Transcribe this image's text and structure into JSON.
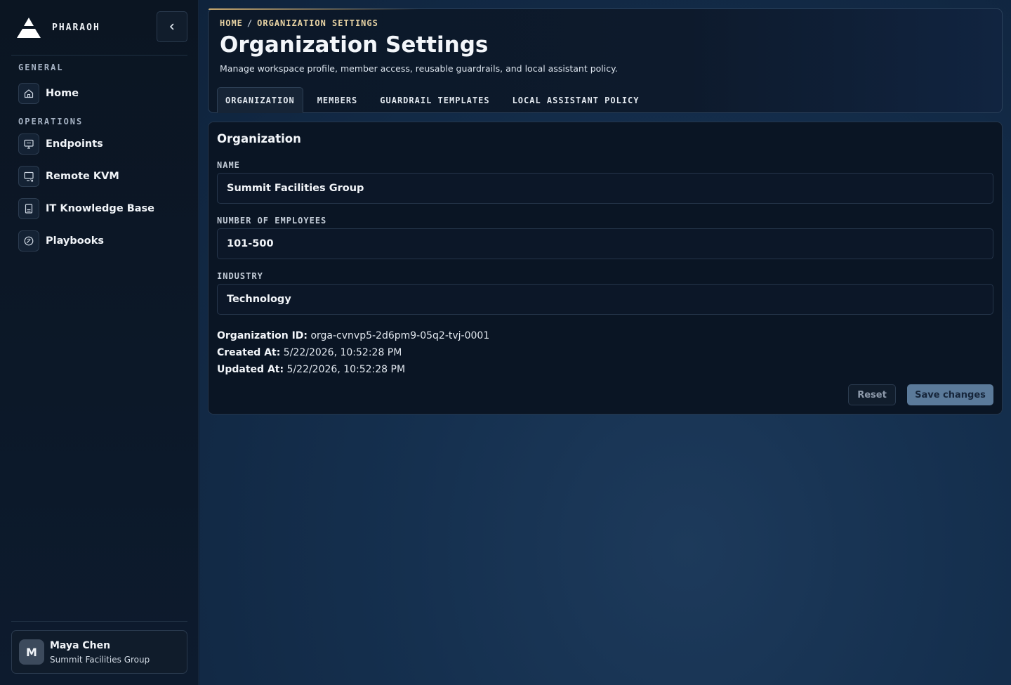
{
  "brand": {
    "name": "PHARAOH"
  },
  "sidebar": {
    "sections": [
      {
        "label": "GENERAL",
        "items": [
          {
            "label": "Home",
            "icon": "home-icon"
          }
        ]
      },
      {
        "label": "OPERATIONS",
        "items": [
          {
            "label": "Endpoints",
            "icon": "endpoints-icon"
          },
          {
            "label": "Remote KVM",
            "icon": "remote-kvm-icon"
          },
          {
            "label": "IT Knowledge Base",
            "icon": "book-icon"
          },
          {
            "label": "Playbooks",
            "icon": "playbook-icon"
          }
        ]
      }
    ]
  },
  "user": {
    "initial": "M",
    "name": "Maya Chen",
    "org": "Summit Facilities Group"
  },
  "header": {
    "breadcrumb": [
      "HOME",
      "ORGANIZATION SETTINGS"
    ],
    "breadcrumb_sep": "/",
    "title": "Organization Settings",
    "subtitle": "Manage workspace profile, member access, reusable guardrails, and local assistant policy.",
    "tabs": [
      {
        "label": "ORGANIZATION",
        "active": true
      },
      {
        "label": "MEMBERS",
        "active": false
      },
      {
        "label": "GUARDRAIL TEMPLATES",
        "active": false
      },
      {
        "label": "LOCAL ASSISTANT POLICY",
        "active": false
      }
    ]
  },
  "organization": {
    "section_title": "Organization",
    "fields": [
      {
        "label": "NAME",
        "value": "Summit Facilities Group"
      },
      {
        "label": "NUMBER OF EMPLOYEES",
        "value": "101-500"
      },
      {
        "label": "INDUSTRY",
        "value": "Technology"
      }
    ],
    "meta": [
      {
        "label": "Organization ID:",
        "value": "orga-cvnvp5-2d6pm9-05q2-tvj-0001"
      },
      {
        "label": "Created At:",
        "value": "5/22/2026, 10:52:28 PM"
      },
      {
        "label": "Updated At:",
        "value": "5/22/2026, 10:52:28 PM"
      }
    ],
    "reset_label": "Reset",
    "save_label": "Save changes"
  },
  "colors": {
    "accent_gold": "#e8d3a4",
    "save_button": "#5b7a9a",
    "panel_bg": "#0a1524"
  }
}
